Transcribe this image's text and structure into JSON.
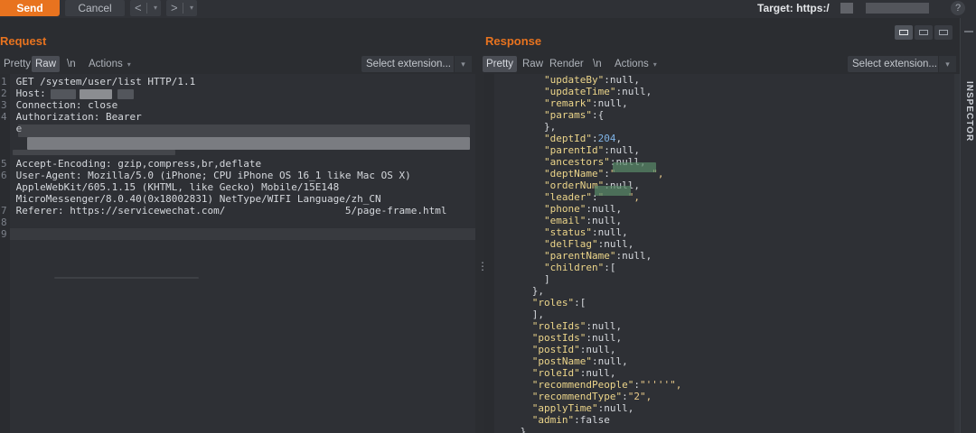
{
  "toolbar": {
    "send_label": "Send",
    "cancel_label": "Cancel",
    "back_glyph": "<",
    "forward_glyph": ">",
    "target_label": "Target: https:/"
  },
  "request": {
    "title": "Request",
    "tabs": [
      "Pretty",
      "Raw",
      "\\n",
      "Actions"
    ],
    "active_tab": "Raw",
    "extension_placeholder": "Select extension...",
    "lines": [
      {
        "n": "1",
        "text": "GET /system/user/list HTTP/1.1"
      },
      {
        "n": "2",
        "text": "Host:"
      },
      {
        "n": "3",
        "text": "Connection: close"
      },
      {
        "n": "4",
        "text": "Authorization: Bearer"
      },
      {
        "n": "",
        "text": "e"
      },
      {
        "n": "",
        "text": ""
      },
      {
        "n": "",
        "text": ""
      },
      {
        "n": "5",
        "text": "Accept-Encoding: gzip,compress,br,deflate"
      },
      {
        "n": "6",
        "text": "User-Agent: Mozilla/5.0 (iPhone; CPU iPhone OS 16_1 like Mac OS X)"
      },
      {
        "n": "",
        "text": "AppleWebKit/605.1.15 (KHTML, like Gecko) Mobile/15E148"
      },
      {
        "n": "",
        "text": "MicroMessenger/8.0.40(0x18002831) NetType/WIFI Language/zh_CN"
      },
      {
        "n": "7",
        "text": "Referer: https://servicewechat.com/                    5/page-frame.html"
      },
      {
        "n": "8",
        "text": ""
      },
      {
        "n": "9",
        "text": ""
      }
    ]
  },
  "response": {
    "title": "Response",
    "tabs": [
      "Pretty",
      "Raw",
      "Render",
      "\\n",
      "Actions"
    ],
    "active_tab": "Pretty",
    "extension_placeholder": "Select extension...",
    "lines": [
      {
        "indent": 5,
        "key": "\"updateBy\"",
        "sep": ":",
        "val": "null,",
        "vtype": "pun"
      },
      {
        "indent": 5,
        "key": "\"updateTime\"",
        "sep": ":",
        "val": "null,",
        "vtype": "pun"
      },
      {
        "indent": 5,
        "key": "\"remark\"",
        "sep": ":",
        "val": "null,",
        "vtype": "pun"
      },
      {
        "indent": 5,
        "key": "\"params\"",
        "sep": ":",
        "val": "{",
        "vtype": "pun"
      },
      {
        "indent": 5,
        "key": "",
        "sep": "",
        "val": "},",
        "vtype": "pun"
      },
      {
        "indent": 5,
        "key": "\"deptId\"",
        "sep": ":",
        "val": "204",
        "vtype": "num",
        "tail": ","
      },
      {
        "indent": 5,
        "key": "\"parentId\"",
        "sep": ":",
        "val": "null,",
        "vtype": "pun"
      },
      {
        "indent": 5,
        "key": "\"ancestors\"",
        "sep": ":",
        "val": "null,",
        "vtype": "pun"
      },
      {
        "indent": 5,
        "key": "\"deptName\"",
        "sep": ":",
        "val": "\"      \",",
        "vtype": "str"
      },
      {
        "indent": 5,
        "key": "\"orderNum\"",
        "sep": ":",
        "val": "null,",
        "vtype": "pun"
      },
      {
        "indent": 5,
        "key": "\"leader\"",
        "sep": ":",
        "val": "\"    \",",
        "vtype": "str"
      },
      {
        "indent": 5,
        "key": "\"phone\"",
        "sep": ":",
        "val": "null,",
        "vtype": "pun"
      },
      {
        "indent": 5,
        "key": "\"email\"",
        "sep": ":",
        "val": "null,",
        "vtype": "pun"
      },
      {
        "indent": 5,
        "key": "\"status\"",
        "sep": ":",
        "val": "null,",
        "vtype": "pun"
      },
      {
        "indent": 5,
        "key": "\"delFlag\"",
        "sep": ":",
        "val": "null,",
        "vtype": "pun"
      },
      {
        "indent": 5,
        "key": "\"parentName\"",
        "sep": ":",
        "val": "null,",
        "vtype": "pun"
      },
      {
        "indent": 5,
        "key": "\"children\"",
        "sep": ":",
        "val": "[",
        "vtype": "pun"
      },
      {
        "indent": 5,
        "key": "",
        "sep": "",
        "val": "]",
        "vtype": "pun"
      },
      {
        "indent": 4,
        "key": "",
        "sep": "",
        "val": "},",
        "vtype": "pun"
      },
      {
        "indent": 4,
        "key": "\"roles\"",
        "sep": ":",
        "val": "[",
        "vtype": "pun"
      },
      {
        "indent": 4,
        "key": "",
        "sep": "",
        "val": "],",
        "vtype": "pun"
      },
      {
        "indent": 4,
        "key": "\"roleIds\"",
        "sep": ":",
        "val": "null,",
        "vtype": "pun"
      },
      {
        "indent": 4,
        "key": "\"postIds\"",
        "sep": ":",
        "val": "null,",
        "vtype": "pun"
      },
      {
        "indent": 4,
        "key": "\"postId\"",
        "sep": ":",
        "val": "null,",
        "vtype": "pun"
      },
      {
        "indent": 4,
        "key": "\"postName\"",
        "sep": ":",
        "val": "null,",
        "vtype": "pun"
      },
      {
        "indent": 4,
        "key": "\"roleId\"",
        "sep": ":",
        "val": "null,",
        "vtype": "pun"
      },
      {
        "indent": 4,
        "key": "\"recommendPeople\"",
        "sep": ":",
        "val": "\"''''\",",
        "vtype": "str"
      },
      {
        "indent": 4,
        "key": "\"recommendType\"",
        "sep": ":",
        "val": "\"2\",",
        "vtype": "str"
      },
      {
        "indent": 4,
        "key": "\"applyTime\"",
        "sep": ":",
        "val": "null,",
        "vtype": "pun"
      },
      {
        "indent": 4,
        "key": "\"admin\"",
        "sep": ":",
        "val": "false",
        "vtype": "pun"
      },
      {
        "indent": 3,
        "key": "",
        "sep": "",
        "val": "}",
        "vtype": "pun"
      }
    ]
  },
  "inspector": {
    "label": "INSPECTOR"
  },
  "colors": {
    "accent": "#e8731f",
    "json_key": "#ecd58a",
    "json_number": "#7fb3e6"
  },
  "icons": [
    "back-arrow-icon",
    "forward-arrow-icon",
    "help-icon",
    "layout-split-icon",
    "chevron-down-icon"
  ]
}
